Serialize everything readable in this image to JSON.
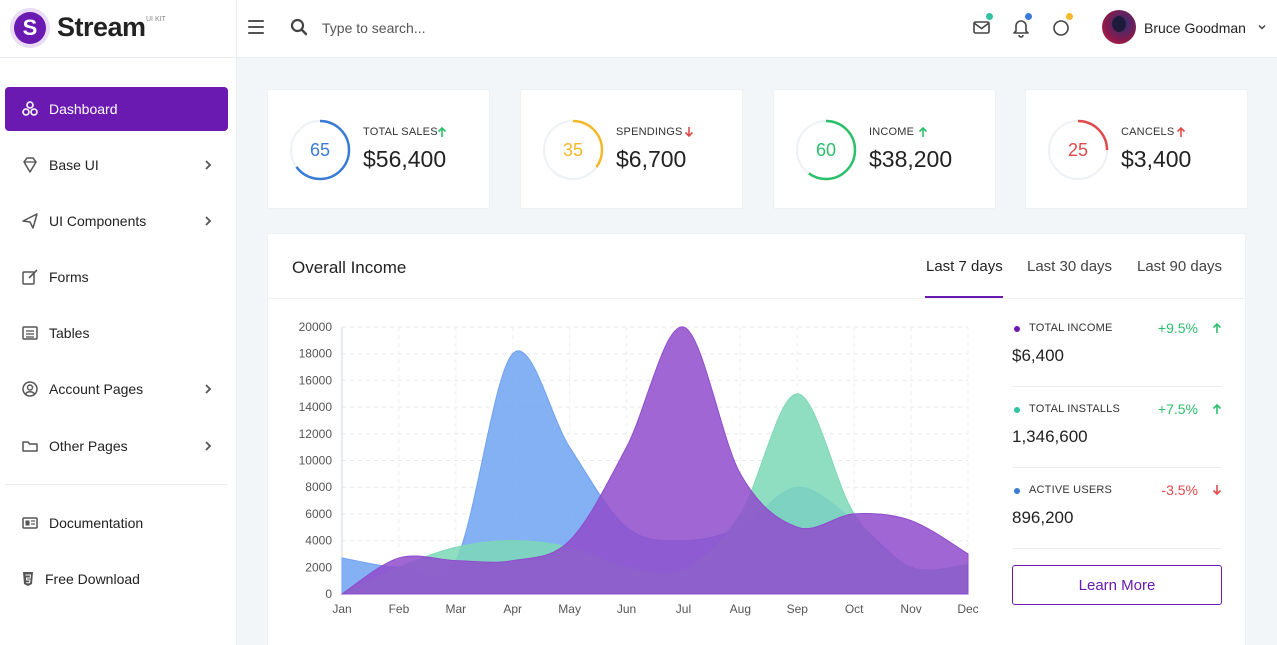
{
  "brand": {
    "logo_letter": "S",
    "name": "Stream",
    "kit": "UI KIT",
    "accent": "#6a1ab1"
  },
  "search": {
    "placeholder": "Type to search..."
  },
  "header": {
    "icons": [
      "mail-icon",
      "bell-icon",
      "activity-ring-icon"
    ],
    "user_name": "Bruce Goodman"
  },
  "sidebar": {
    "items": [
      {
        "label": "Dashboard",
        "icon": "dashboard-icon",
        "active": true,
        "submenu": false
      },
      {
        "label": "Base UI",
        "icon": "diamond-icon",
        "active": false,
        "submenu": true
      },
      {
        "label": "UI Components",
        "icon": "paper-plane-icon",
        "active": false,
        "submenu": true
      },
      {
        "label": "Forms",
        "icon": "edit-icon",
        "active": false,
        "submenu": false
      },
      {
        "label": "Tables",
        "icon": "table-icon",
        "active": false,
        "submenu": false
      },
      {
        "label": "Account Pages",
        "icon": "user-circle-icon",
        "active": false,
        "submenu": true
      },
      {
        "label": "Other Pages",
        "icon": "folder-icon",
        "active": false,
        "submenu": true
      }
    ],
    "bottom_items": [
      {
        "label": "Documentation",
        "icon": "document-icon"
      },
      {
        "label": "Free Download",
        "icon": "html5-icon"
      }
    ]
  },
  "stats": [
    {
      "ring_value": "65",
      "label": "TOTAL SALES",
      "amount": "$56,400",
      "trend": "up",
      "color": "#3a7bd5",
      "trend_color": "#2bbf6a",
      "ring_fraction": 0.65
    },
    {
      "ring_value": "35",
      "label": "SPENDINGS",
      "amount": "$6,700",
      "trend": "down",
      "color": "#f5b72c",
      "trend_color": "#e04a4a",
      "ring_fraction": 0.35
    },
    {
      "ring_value": "60",
      "label": "INCOME",
      "amount": "$38,200",
      "trend": "up",
      "color": "#2bbf6a",
      "trend_color": "#2bbf6a",
      "ring_fraction": 0.6
    },
    {
      "ring_value": "25",
      "label": "CANCELS",
      "amount": "$3,400",
      "trend": "up",
      "color": "#e04a4a",
      "trend_color": "#e04a4a",
      "ring_fraction": 0.25
    }
  ],
  "income": {
    "title": "Overall Income",
    "tabs": [
      "Last 7 days",
      "Last 30 days",
      "Last 90 days"
    ],
    "active_tab": 0,
    "metrics": [
      {
        "label": "TOTAL INCOME",
        "value": "$6,400",
        "change": "+9.5%",
        "trend": "up",
        "dot_color": "#6a1ab1",
        "change_color": "#2bbf6a"
      },
      {
        "label": "TOTAL INSTALLS",
        "value": "1,346,600",
        "change": "+7.5%",
        "trend": "up",
        "dot_color": "#2ec4a0",
        "change_color": "#2bbf6a"
      },
      {
        "label": "ACTIVE USERS",
        "value": "896,200",
        "change": "-3.5%",
        "trend": "down",
        "dot_color": "#3a7bd5",
        "change_color": "#e04a4a"
      }
    ],
    "learn_more": "Learn More"
  },
  "chart_data": {
    "type": "area",
    "x": [
      "Jan",
      "Feb",
      "Mar",
      "Apr",
      "May",
      "Jun",
      "Jul",
      "Aug",
      "Sep",
      "Oct",
      "Nov",
      "Dec"
    ],
    "ylim": [
      0,
      20000
    ],
    "yticks": [
      0,
      2000,
      4000,
      6000,
      8000,
      10000,
      12000,
      14000,
      16000,
      18000,
      20000
    ],
    "grid": true,
    "series": [
      {
        "color": "#6fa2f2",
        "values": [
          2700,
          2000,
          2500,
          18000,
          11000,
          5000,
          4000,
          5000,
          8000,
          5500,
          2000,
          2200
        ]
      },
      {
        "color": "#7cd8b7",
        "values": [
          0,
          2000,
          3500,
          4000,
          3500,
          2000,
          1800,
          6000,
          15000,
          6000,
          2000,
          2200
        ]
      },
      {
        "color": "#8f4ccc",
        "values": [
          0,
          2700,
          2500,
          2500,
          4000,
          11000,
          20000,
          9000,
          5000,
          6000,
          5500,
          3000
        ]
      }
    ]
  }
}
